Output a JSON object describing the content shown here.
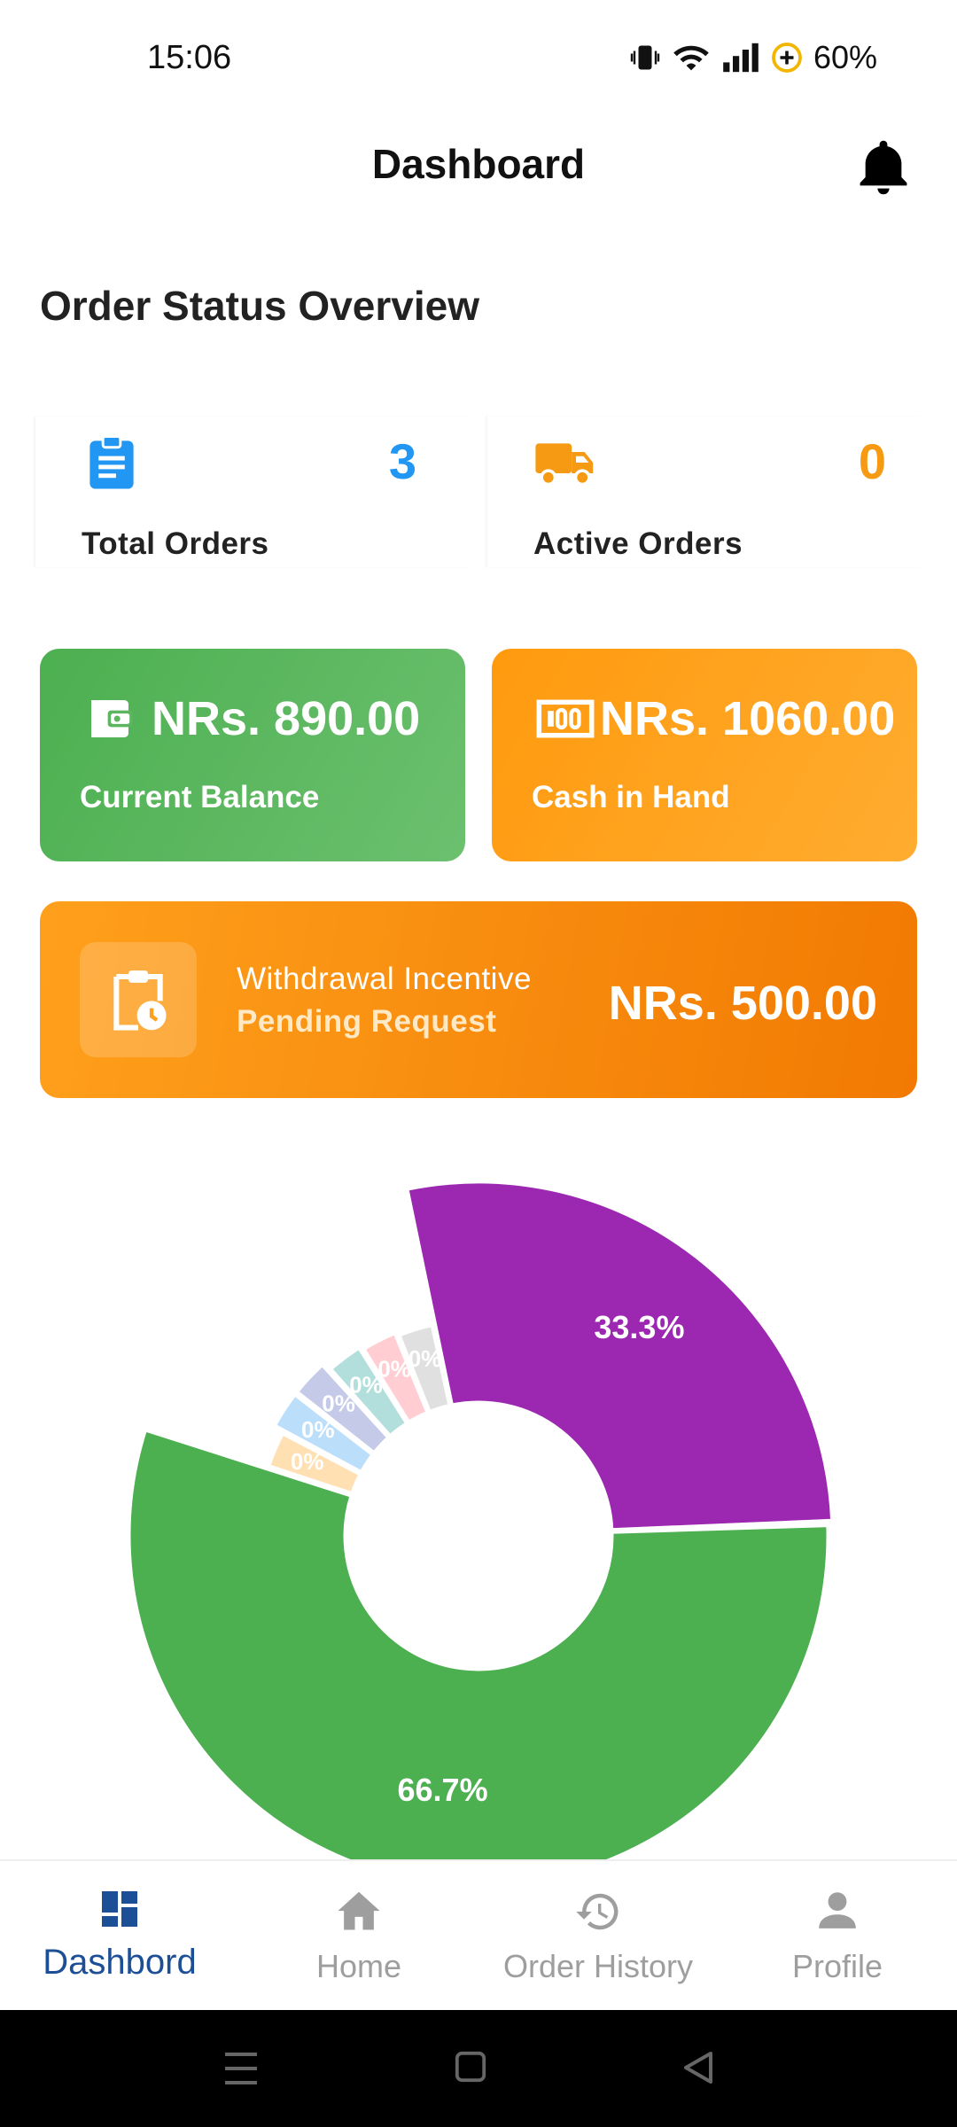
{
  "status_bar": {
    "time": "15:06",
    "battery": "60%",
    "icons": [
      "vibrate-icon",
      "wifi-icon",
      "signal-icon",
      "battery-saver-icon"
    ]
  },
  "app_bar": {
    "title": "Dashboard",
    "bell_icon": "bell-icon"
  },
  "section": {
    "title": "Order Status Overview"
  },
  "stats": {
    "total_orders": {
      "icon": "clipboard-icon",
      "value": "3",
      "label": "Total Orders",
      "color": "#2196f3"
    },
    "active_orders": {
      "icon": "truck-icon",
      "value": "0",
      "label": "Active Orders",
      "color": "#f59a12"
    }
  },
  "balances": {
    "current": {
      "icon": "wallet-icon",
      "amount": "NRs. 890.00",
      "label": "Current Balance",
      "color": "#4caf50"
    },
    "cash": {
      "icon": "cash-icon",
      "amount": "NRs. 1060.00",
      "label": "Cash in Hand",
      "color": "#ff9a0e"
    }
  },
  "withdrawal": {
    "icon": "clipboard-clock-icon",
    "title": "Withdrawal Incentive",
    "subtitle": "Pending Request",
    "amount": "NRs. 500.00"
  },
  "chart_data": {
    "type": "pie",
    "donut": true,
    "slices": [
      {
        "value": 33.3,
        "label": "33.3%",
        "color": "#9c27b0"
      },
      {
        "value": 66.7,
        "label": "66.7%",
        "color": "#4caf50"
      },
      {
        "value": 0,
        "label": "0%",
        "color": "#ffe0b2"
      },
      {
        "value": 0,
        "label": "0%",
        "color": "#bbdefb"
      },
      {
        "value": 0,
        "label": "0%",
        "color": "#c5cae9"
      },
      {
        "value": 0,
        "label": "0%",
        "color": "#b2dfdb"
      },
      {
        "value": 0,
        "label": "0%",
        "color": "#ffcdd2"
      },
      {
        "value": 0,
        "label": "0%",
        "color": "#e0e0e0"
      }
    ]
  },
  "bottom_nav": {
    "items": [
      {
        "label": "Dashbord",
        "icon": "dashboard-icon",
        "active": true
      },
      {
        "label": "Home",
        "icon": "home-icon",
        "active": false
      },
      {
        "label": "Order History",
        "icon": "history-icon",
        "active": false
      },
      {
        "label": "Profile",
        "icon": "person-icon",
        "active": false
      }
    ]
  },
  "system_nav": {
    "icons": [
      "menu-icon",
      "home-square-icon",
      "back-icon"
    ]
  }
}
